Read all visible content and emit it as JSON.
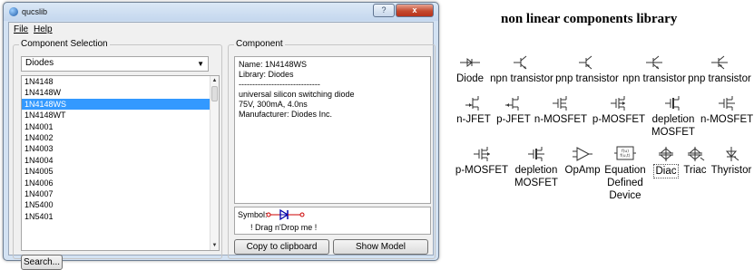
{
  "window": {
    "title": "qucslib",
    "help_button": "?",
    "close_button": "x"
  },
  "menu": {
    "file": "File",
    "help": "Help"
  },
  "component_selection": {
    "group_title": "Component Selection",
    "combo_value": "Diodes",
    "items": [
      "1N4148",
      "1N4148W",
      "1N4148WS",
      "1N4148WT",
      "1N4001",
      "1N4002",
      "1N4003",
      "1N4004",
      "1N4005",
      "1N4006",
      "1N4007",
      "1N5400",
      "1N5401"
    ],
    "selected_index": 2,
    "search_button": "Search..."
  },
  "component": {
    "group_title": "Component",
    "info_lines": [
      "Name: 1N4148WS",
      "Library: Diodes",
      "------------------------------",
      "universal silicon switching diode",
      "75V, 300mA, 4.0ns",
      "Manufacturer: Diodes Inc."
    ],
    "symbol_label": "Symbol:",
    "drag_hint": "! Drag n'Drop me !",
    "copy_button": "Copy to clipboard",
    "show_model_button": "Show Model"
  },
  "library_panel": {
    "title": "non linear components library",
    "components": [
      {
        "label": "Diode",
        "icon": "diode-icon"
      },
      {
        "label": "npn transistor",
        "icon": "npn-transistor-icon"
      },
      {
        "label": "pnp transistor",
        "icon": "pnp-transistor-icon"
      },
      {
        "label": "npn transistor",
        "icon": "npn-transistor-icon"
      },
      {
        "label": "pnp transistor",
        "icon": "pnp-transistor-icon"
      },
      {
        "label": "n-JFET",
        "icon": "n-jfet-icon"
      },
      {
        "label": "p-JFET",
        "icon": "p-jfet-icon"
      },
      {
        "label": "n-MOSFET",
        "icon": "n-mosfet-icon"
      },
      {
        "label": "p-MOSFET",
        "icon": "p-mosfet-icon"
      },
      {
        "label": "depletion MOSFET",
        "icon": "depletion-mosfet-icon"
      },
      {
        "label": "n-MOSFET",
        "icon": "n-mosfet-icon"
      },
      {
        "label": "p-MOSFET",
        "icon": "p-mosfet-icon"
      },
      {
        "label": "depletion MOSFET",
        "icon": "depletion-mosfet-icon"
      },
      {
        "label": "OpAmp",
        "icon": "opamp-icon"
      },
      {
        "label": "Equation Defined Device",
        "icon": "equation-defined-device-icon"
      },
      {
        "label": "Diac",
        "icon": "diac-icon"
      },
      {
        "label": "Triac",
        "icon": "triac-icon"
      },
      {
        "label": "Thyristor",
        "icon": "thyristor-icon"
      }
    ],
    "eqn_icon_text": "f(u)\nf(u,t)"
  },
  "colors": {
    "selection": "#3399ff",
    "symbol_red": "#cc0000",
    "symbol_blue": "#0000aa"
  }
}
